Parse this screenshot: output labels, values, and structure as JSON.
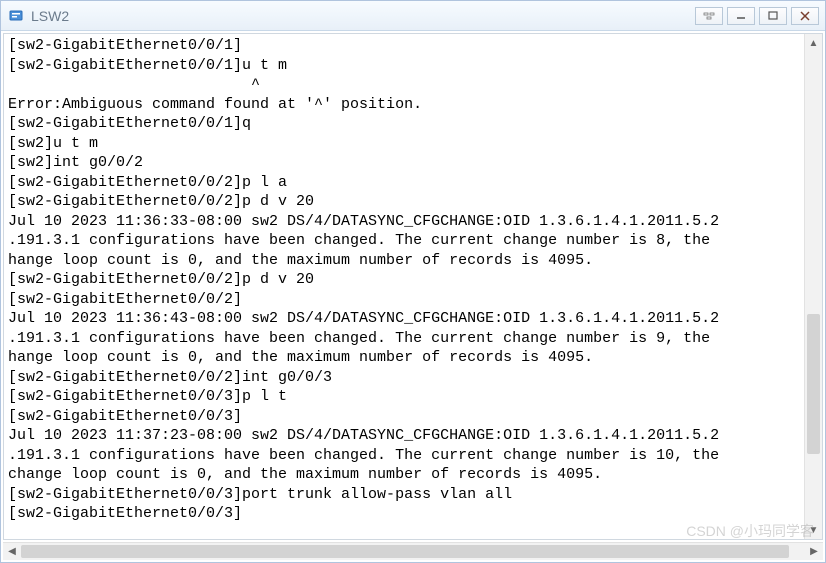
{
  "window": {
    "title": "LSW2"
  },
  "terminal": {
    "lines": [
      "[sw2-GigabitEthernet0/0/1]",
      "[sw2-GigabitEthernet0/0/1]u t m",
      "                           ^",
      "Error:Ambiguous command found at '^' position.",
      "[sw2-GigabitEthernet0/0/1]q",
      "[sw2]u t m",
      "[sw2]int g0/0/2",
      "[sw2-GigabitEthernet0/0/2]p l a",
      "[sw2-GigabitEthernet0/0/2]p d v 20",
      "Jul 10 2023 11:36:33-08:00 sw2 DS/4/DATASYNC_CFGCHANGE:OID 1.3.6.1.4.1.2011.5.2",
      ".191.3.1 configurations have been changed. The current change number is 8, the ",
      "hange loop count is 0, and the maximum number of records is 4095.",
      "[sw2-GigabitEthernet0/0/2]p d v 20",
      "[sw2-GigabitEthernet0/0/2]",
      "Jul 10 2023 11:36:43-08:00 sw2 DS/4/DATASYNC_CFGCHANGE:OID 1.3.6.1.4.1.2011.5.2",
      ".191.3.1 configurations have been changed. The current change number is 9, the ",
      "hange loop count is 0, and the maximum number of records is 4095.",
      "[sw2-GigabitEthernet0/0/2]int g0/0/3",
      "[sw2-GigabitEthernet0/0/3]p l t",
      "[sw2-GigabitEthernet0/0/3]",
      "Jul 10 2023 11:37:23-08:00 sw2 DS/4/DATASYNC_CFGCHANGE:OID 1.3.6.1.4.1.2011.5.2",
      ".191.3.1 configurations have been changed. The current change number is 10, the",
      "change loop count is 0, and the maximum number of records is 4095.",
      "[sw2-GigabitEthernet0/0/3]port trunk allow-pass vlan all",
      "[sw2-GigabitEthernet0/0/3]"
    ]
  },
  "watermark": "CSDN @小玛同学客"
}
